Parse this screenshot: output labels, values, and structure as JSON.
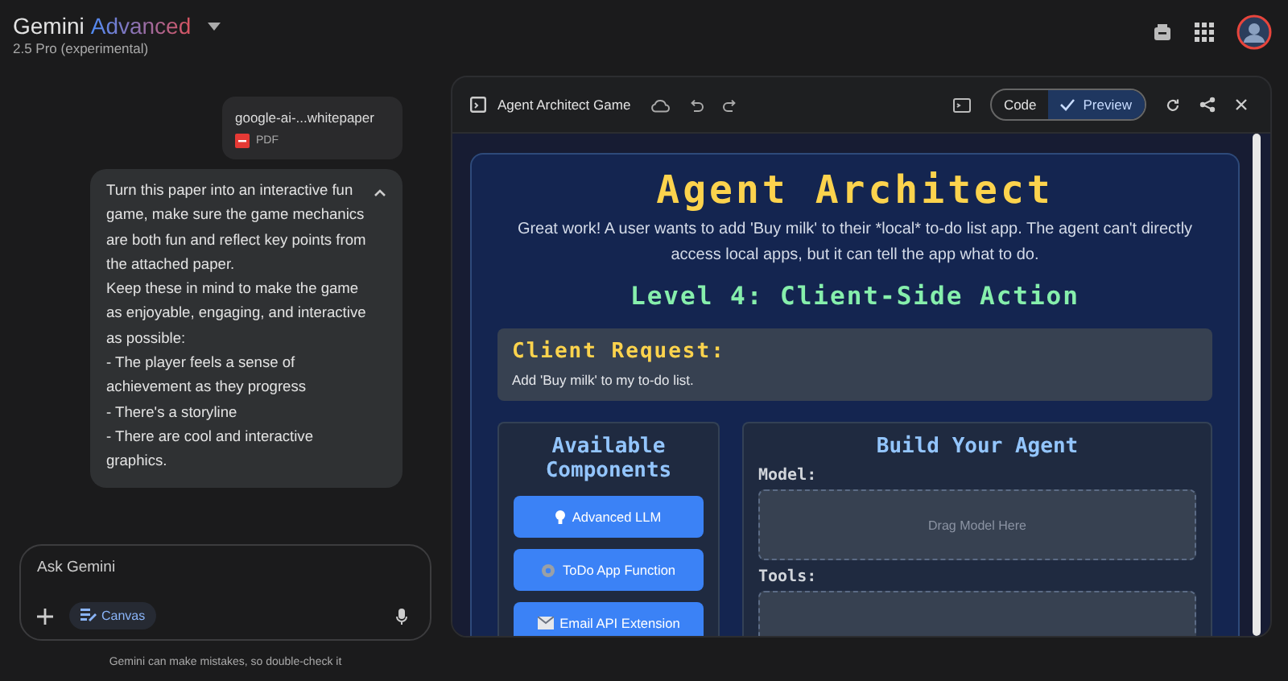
{
  "header": {
    "brand": "Gemini",
    "tier": "Advanced",
    "model": "2.5 Pro (experimental)"
  },
  "chat": {
    "attachment": {
      "name": "google-ai-...whitepaper",
      "type": "PDF"
    },
    "message": {
      "expanded": true,
      "paragraphs": [
        "Turn this paper into an interactive fun game, make sure the game mechanics are both fun and reflect key points from the attached paper.",
        "Keep these in mind to make the game as enjoyable, engaging, and interactive as possible:",
        "- The player feels a sense of achievement as they progress",
        "- There's a storyline",
        "- There are cool and interactive graphics."
      ]
    },
    "input": {
      "placeholder": "Ask Gemini",
      "tool": "Canvas"
    },
    "disclaimer": "Gemini can make mistakes, so double-check it"
  },
  "preview": {
    "title": "Agent Architect Game",
    "toggle": [
      {
        "label": "Code",
        "selected": false
      },
      {
        "label": "Preview",
        "selected": true
      }
    ],
    "game": {
      "title": "Agent Architect",
      "intro": "Great work! A user wants to add 'Buy milk' to their *local* to-do list app. The agent can't directly access local apps, but it can tell the app what to do.",
      "level": "Level 4: Client-Side Action",
      "request": {
        "heading": "Client Request:",
        "text": "Add 'Buy milk' to my to-do list."
      },
      "components": {
        "heading": "Available Components",
        "items": [
          {
            "kind": "bulb",
            "label": "Advanced LLM"
          },
          {
            "kind": "gear",
            "label": "ToDo App Function"
          },
          {
            "kind": "mail",
            "label": "Email API Extension"
          }
        ]
      },
      "build": {
        "heading": "Build Your Agent",
        "slots": [
          {
            "label": "Model:",
            "placeholder": "Drag Model Here"
          },
          {
            "label": "Tools:"
          }
        ]
      }
    }
  }
}
